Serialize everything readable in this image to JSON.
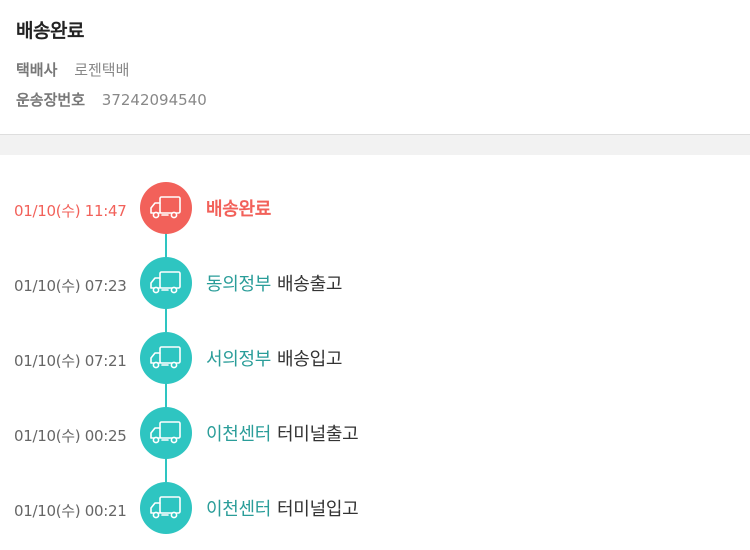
{
  "header": {
    "title": "배송완료",
    "carrier_label": "택배사",
    "carrier_value": "로젠택배",
    "tracking_label": "운송장번호",
    "tracking_value": "37242094540"
  },
  "colors": {
    "accent_active": "#f2615a",
    "accent_normal": "#2ec5c1",
    "location_text": "#2a9d99"
  },
  "timeline": [
    {
      "time": "01/10(수) 11:47",
      "location": "",
      "status": "배송완료",
      "icon": "delivery-truck-icon",
      "active": true
    },
    {
      "time": "01/10(수) 07:23",
      "location": "동의정부",
      "status": "배송출고",
      "icon": "delivery-truck-icon",
      "active": false
    },
    {
      "time": "01/10(수) 07:21",
      "location": "서의정부",
      "status": "배송입고",
      "icon": "delivery-truck-icon",
      "active": false
    },
    {
      "time": "01/10(수) 00:25",
      "location": "이천센터",
      "status": "터미널출고",
      "icon": "delivery-truck-icon",
      "active": false
    },
    {
      "time": "01/10(수) 00:21",
      "location": "이천센터",
      "status": "터미널입고",
      "icon": "delivery-truck-icon",
      "active": false
    }
  ]
}
